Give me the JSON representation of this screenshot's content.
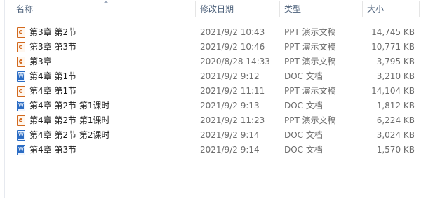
{
  "columns": {
    "name": "名称",
    "date": "修改日期",
    "type": "类型",
    "size": "大小"
  },
  "files": [
    {
      "name": "第3章 第2节",
      "date": "2021/9/2 10:43",
      "type": "PPT 演示文稿",
      "size": "14,745 KB",
      "icon": "ppt-file-icon"
    },
    {
      "name": "第3章 第3节",
      "date": "2021/9/2 10:46",
      "type": "PPT 演示文稿",
      "size": "10,771 KB",
      "icon": "ppt-file-icon"
    },
    {
      "name": "第3章",
      "date": "2020/8/28 14:33",
      "type": "PPT 演示文稿",
      "size": "3,795 KB",
      "icon": "ppt-file-icon"
    },
    {
      "name": "第4章 第1节",
      "date": "2021/9/2 9:12",
      "type": "DOC 文档",
      "size": "3,210 KB",
      "icon": "doc-file-icon"
    },
    {
      "name": "第4章 第1节",
      "date": "2021/9/2 11:11",
      "type": "PPT 演示文稿",
      "size": "14,104 KB",
      "icon": "ppt-file-icon"
    },
    {
      "name": "第4章 第2节 第1课时",
      "date": "2021/9/2 9:13",
      "type": "DOC 文档",
      "size": "1,812 KB",
      "icon": "doc-file-icon"
    },
    {
      "name": "第4章 第2节 第1课时",
      "date": "2021/9/2 11:23",
      "type": "PPT 演示文稿",
      "size": "6,224 KB",
      "icon": "ppt-file-icon"
    },
    {
      "name": "第4章 第2节 第2课时",
      "date": "2021/9/2 9:14",
      "type": "DOC 文档",
      "size": "3,024 KB",
      "icon": "doc-file-icon"
    },
    {
      "name": "第4章 第3节",
      "date": "2021/9/2 9:14",
      "type": "DOC 文档",
      "size": "1,570 KB",
      "icon": "doc-file-icon"
    }
  ]
}
